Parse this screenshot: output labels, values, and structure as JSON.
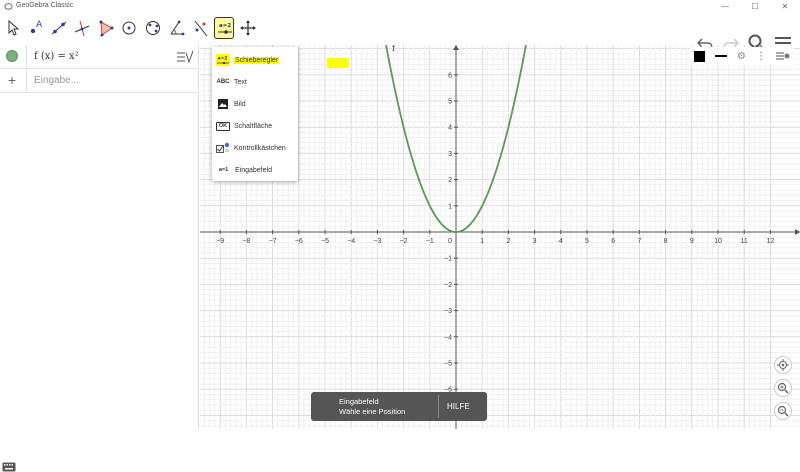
{
  "window": {
    "title": "GeoGebra Classic",
    "controls": [
      "—",
      "☐",
      "✕"
    ]
  },
  "toolbar": {
    "tools": [
      {
        "name": "move-tool-icon",
        "active": false
      },
      {
        "name": "point-tool-icon",
        "active": false
      },
      {
        "name": "line-tool-icon",
        "active": false
      },
      {
        "name": "perpendicular-line-tool-icon",
        "active": false
      },
      {
        "name": "polygon-tool-icon",
        "active": false
      },
      {
        "name": "circle-tool-icon",
        "active": false
      },
      {
        "name": "ellipse-tool-icon",
        "active": false
      },
      {
        "name": "angle-tool-icon",
        "active": false
      },
      {
        "name": "reflect-tool-icon",
        "active": false
      },
      {
        "name": "slider-tool-icon",
        "active": true
      },
      {
        "name": "move-graphics-tool-icon",
        "active": false
      }
    ],
    "right": [
      "undo-icon",
      "redo-icon",
      "search-icon",
      "menu-icon"
    ]
  },
  "algebra": {
    "expression": "f (x)  =  x²",
    "input_placeholder": "Eingabe..."
  },
  "dropdown": {
    "items": [
      {
        "icon": "slider-icon",
        "label": "Schieberegler",
        "active": true
      },
      {
        "icon": "text-icon",
        "label": "Text",
        "active": false,
        "icon_text": "ABC"
      },
      {
        "icon": "image-icon",
        "label": "Bild",
        "active": false
      },
      {
        "icon": "button-icon",
        "label": "Schaltfläche",
        "active": false,
        "icon_text": "OK"
      },
      {
        "icon": "checkbox-icon",
        "label": "Kontrollkästchen",
        "active": false
      },
      {
        "icon": "input-box-icon",
        "label": "Eingabefeld",
        "active": false,
        "icon_text": "a=1"
      }
    ]
  },
  "graphics": {
    "function_label": "f",
    "x_ticks": [
      -9,
      -8,
      -7,
      -6,
      -5,
      -4,
      -3,
      -2,
      -1,
      0,
      1,
      2,
      3,
      4,
      5,
      6,
      7,
      8,
      9,
      10,
      11,
      12
    ],
    "y_ticks": [
      6,
      5,
      4,
      3,
      2,
      1,
      -1,
      -2,
      -3,
      -4,
      -5,
      -6
    ],
    "curve_color": "#5b9a5b",
    "grid_color": "#e6e6e6",
    "axis_color": "#555555"
  },
  "snackbar": {
    "title": "Eingabefeld",
    "subtitle": "Wähle eine Position",
    "help": "HILFE"
  },
  "colors": {
    "accent_yellow": "#ffff00",
    "marker_green": "#7fb07f"
  }
}
